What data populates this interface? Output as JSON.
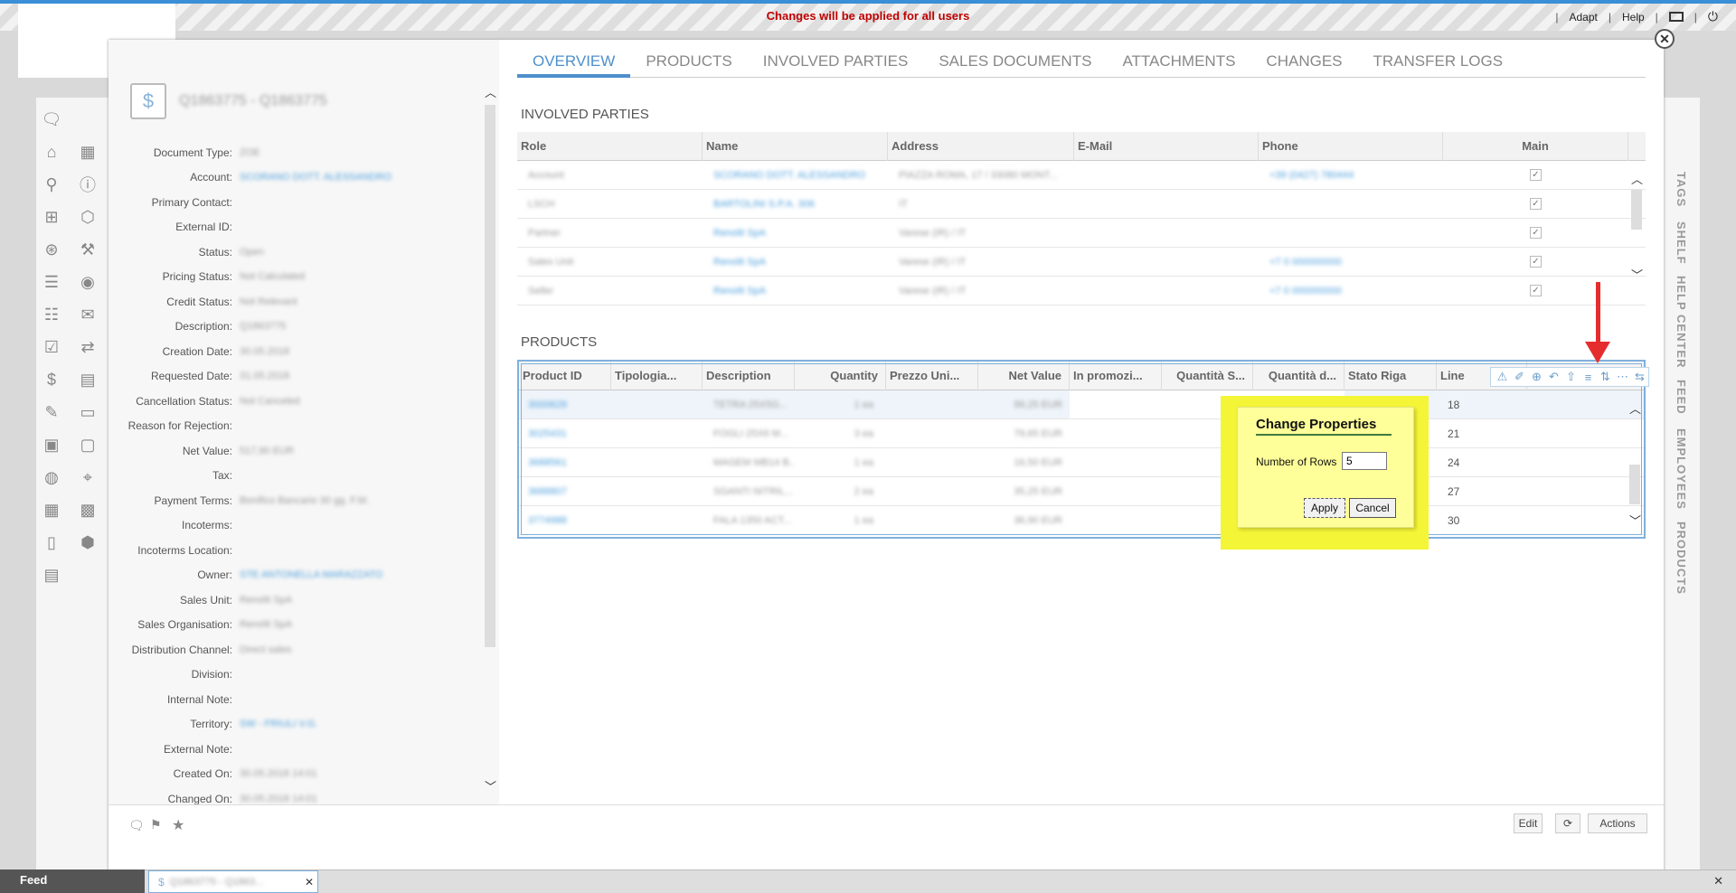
{
  "topbar": {
    "warning": "Changes will be applied for all users",
    "links": [
      "Adapt",
      "Help"
    ],
    "icons": [
      "window-icon",
      "power-icon"
    ]
  },
  "leftnav": {
    "icons": [
      "chat-icon",
      "home-icon",
      "calendar-icon",
      "search-icon",
      "alert-icon",
      "hierarchy-icon",
      "box-icon",
      "download-icon",
      "tools-icon",
      "list-icon",
      "user-icon",
      "contacts-icon",
      "mail-icon",
      "checklist-icon",
      "transfer-icon",
      "money-icon",
      "chart-icon",
      "document-icon",
      "invoice-icon",
      "stack-icon",
      "price-icon",
      "globe-icon",
      "map-icon",
      "calendar2-icon",
      "calculator-icon",
      "clipboard-icon",
      "package-icon",
      "report-icon"
    ]
  },
  "detail": {
    "title": "Q1863775 - Q1863775",
    "fields": [
      {
        "label": "Document Type:",
        "value": "ZOE"
      },
      {
        "label": "Account:",
        "value": "SCORANO DOTT. ALESSANDRO",
        "link": true
      },
      {
        "label": "Primary Contact:",
        "value": ""
      },
      {
        "label": "External ID:",
        "value": ""
      },
      {
        "label": "Status:",
        "value": "Open"
      },
      {
        "label": "Pricing Status:",
        "value": "Not Calculated"
      },
      {
        "label": "Credit Status:",
        "value": "Not Relevant"
      },
      {
        "label": "Description:",
        "value": "Q1863775"
      },
      {
        "label": "Creation Date:",
        "value": "30.05.2018"
      },
      {
        "label": "Requested Date:",
        "value": "31.05.2018"
      },
      {
        "label": "Cancellation Status:",
        "value": "Not Canceled"
      },
      {
        "label": "Reason for Rejection:",
        "value": ""
      },
      {
        "label": "Net Value:",
        "value": "517,90 EUR"
      },
      {
        "label": "Tax:",
        "value": ""
      },
      {
        "label": "Payment Terms:",
        "value": "Bonifico Bancario 30 gg. F.M."
      },
      {
        "label": "Incoterms:",
        "value": ""
      },
      {
        "label": "Incoterms Location:",
        "value": ""
      },
      {
        "label": "Owner:",
        "value": "STE ANTONELLA MARAZZATO",
        "link": true
      },
      {
        "label": "Sales Unit:",
        "value": "Renolit SpA"
      },
      {
        "label": "Sales Organisation:",
        "value": "Renolit SpA"
      },
      {
        "label": "Distribution Channel:",
        "value": "Direct sales"
      },
      {
        "label": "Division:",
        "value": ""
      },
      {
        "label": "Internal Note:",
        "value": ""
      },
      {
        "label": "Territory:",
        "value": "SW - FRIULI V.G.",
        "link": true
      },
      {
        "label": "External Note:",
        "value": ""
      },
      {
        "label": "Created On:",
        "value": "30.05.2018 14:01"
      },
      {
        "label": "Changed On:",
        "value": "30.05.2018 14:01"
      }
    ]
  },
  "tabs": [
    "OVERVIEW",
    "PRODUCTS",
    "INVOLVED PARTIES",
    "SALES DOCUMENTS",
    "ATTACHMENTS",
    "CHANGES",
    "TRANSFER LOGS"
  ],
  "involved": {
    "title": "INVOLVED PARTIES",
    "columns": [
      "Role",
      "Name",
      "Address",
      "E-Mail",
      "Phone",
      "Main"
    ],
    "rows": [
      {
        "role": "Account",
        "name": "SCORANO DOTT. ALESSANDRO",
        "address": "PIAZZA ROMA, 17 / 33080 MONT...",
        "email": "",
        "phone": "+39 (0427) 780444"
      },
      {
        "role": "LSCH",
        "name": "BARTOLINI S.P.A. 306",
        "address": "IT",
        "email": "",
        "phone": ""
      },
      {
        "role": "Partner",
        "name": "Renolit SpA",
        "address": "Varese (IR) / IT",
        "email": "",
        "phone": ""
      },
      {
        "role": "Sales Unit",
        "name": "Renolit SpA",
        "address": "Varese (IR) / IT",
        "email": "",
        "phone": "+7 0 000000000"
      },
      {
        "role": "Seller",
        "name": "Renolit SpA",
        "address": "Varese (IR) / IT",
        "email": "",
        "phone": "+7 0 000000000"
      }
    ]
  },
  "products": {
    "title": "PRODUCTS",
    "columns": [
      "Product ID",
      "Tipologia...",
      "Description",
      "Quantity",
      "Prezzo Uni...",
      "Net Value",
      "In promozi...",
      "Quantità S...",
      "Quantità d...",
      "Stato Riga",
      "Line"
    ],
    "rows": [
      {
        "id": "3000629",
        "desc": "TETRA 25X5G...",
        "qty": "1 ea",
        "net": "99,25 EUR",
        "line": "18"
      },
      {
        "id": "3025431",
        "desc": "FOGLI 25X6 M...",
        "qty": "3 ea",
        "net": "79,65 EUR",
        "line": "21"
      },
      {
        "id": "3688561",
        "desc": "MAGEM MB14 B...",
        "qty": "1 ea",
        "net": "16,50 EUR",
        "line": "24"
      },
      {
        "id": "3688807",
        "desc": "SGANTI NITRIL...",
        "qty": "2 ea",
        "net": "35,25 EUR",
        "line": "27"
      },
      {
        "id": "3774988",
        "desc": "FALA 1350 ACT...",
        "qty": "1 ea",
        "net": "36,90 EUR",
        "line": "30"
      }
    ]
  },
  "dialog": {
    "title": "Change Properties",
    "rows_label": "Number of Rows",
    "rows_value": "5",
    "apply": "Apply",
    "cancel": "Cancel"
  },
  "sidebar": [
    "TAGS",
    "SHELF",
    "HELP CENTER",
    "FEED",
    "EMPLOYEES",
    "PRODUCTS"
  ],
  "bottom": {
    "edit": "Edit",
    "actions": "Actions"
  },
  "taskbar": {
    "feed": "Feed",
    "tab": "Q1863775 - Q1863..."
  },
  "colors": {
    "accent": "#4d8fcc",
    "warning": "#c00000",
    "highlight": "#f5f538",
    "arrow": "#e52d2d"
  }
}
